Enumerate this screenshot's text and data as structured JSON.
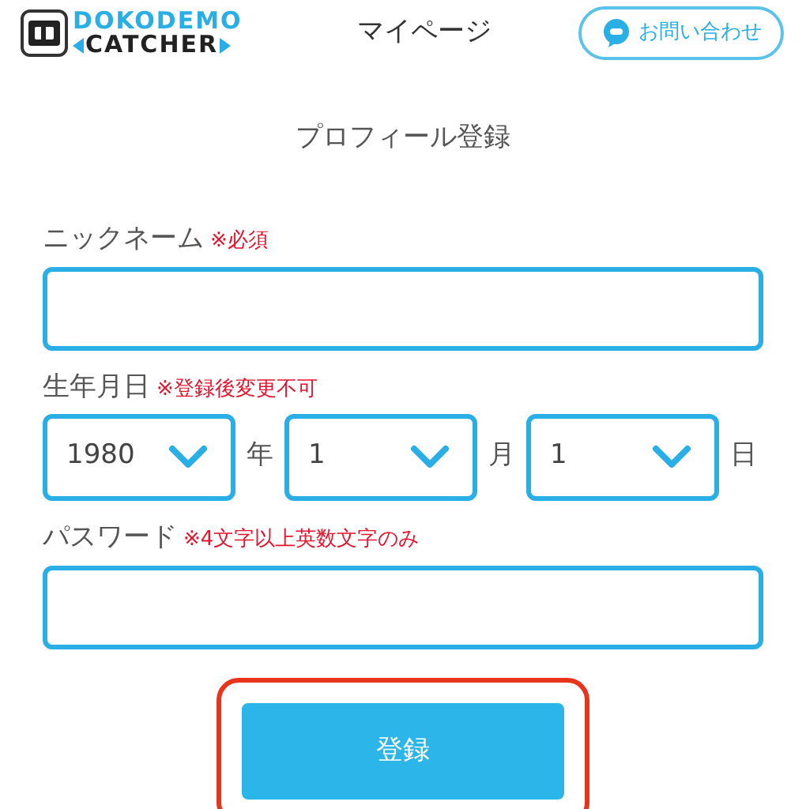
{
  "header": {
    "logo": {
      "line1": "DOKODEMO",
      "line2": "CATCHER"
    },
    "title": "マイページ",
    "contact_button": "お問い合わせ"
  },
  "page_title": "プロフィール登録",
  "fields": [
    {
      "kind": "text",
      "label": "ニックネーム",
      "note": "※必須"
    },
    {
      "kind": "date",
      "label": "生年月日",
      "note": "※登録後変更不可",
      "selects": [
        {
          "value": "1980",
          "unit": "年"
        },
        {
          "value": "1",
          "unit": "月"
        },
        {
          "value": "1",
          "unit": "日"
        }
      ]
    },
    {
      "kind": "password",
      "label": "パスワード",
      "note": "※4文字以上英数文字のみ"
    }
  ],
  "submit": {
    "label": "登録",
    "highlighted": true
  }
}
